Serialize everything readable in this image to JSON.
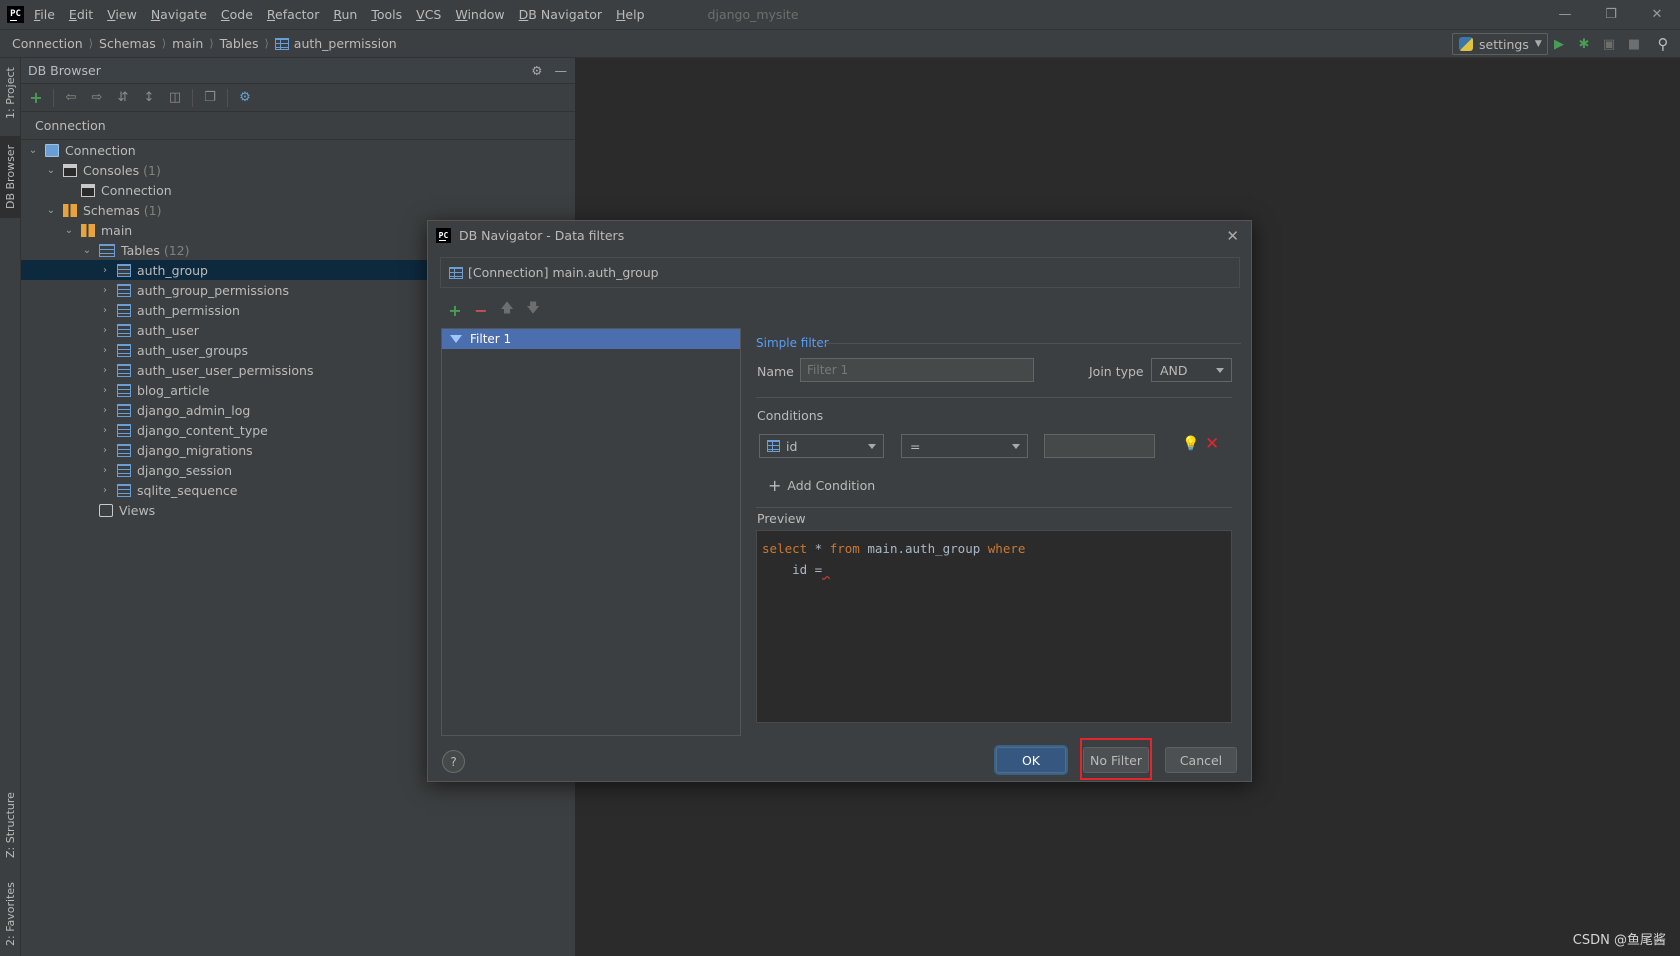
{
  "menubar": {
    "items": [
      "File",
      "Edit",
      "View",
      "Navigate",
      "Code",
      "Refactor",
      "Run",
      "Tools",
      "VCS",
      "Window",
      "DB Navigator",
      "Help"
    ],
    "project": "django_mysite"
  },
  "breadcrumb": [
    "Connection",
    "Schemas",
    "main",
    "Tables",
    "auth_permission"
  ],
  "run_config": "settings",
  "stripe": {
    "project": "1: Project",
    "db_browser": "DB Browser",
    "structure": "Z: Structure",
    "favorites": "2: Favorites"
  },
  "panel": {
    "title": "DB Browser",
    "column_header": "Connection"
  },
  "tree": {
    "connection": "Connection",
    "consoles": "Consoles",
    "consoles_count": "(1)",
    "console_conn": "Connection",
    "schemas": "Schemas",
    "schemas_count": "(1)",
    "main": "main",
    "tables": "Tables",
    "tables_count": "(12)",
    "table_items": [
      "auth_group",
      "auth_group_permissions",
      "auth_permission",
      "auth_user",
      "auth_user_groups",
      "auth_user_user_permissions",
      "blog_article",
      "django_admin_log",
      "django_content_type",
      "django_migrations",
      "django_session",
      "sqlite_sequence"
    ],
    "views": "Views"
  },
  "dialog": {
    "title": "DB Navigator - Data filters",
    "header": "[Connection] main.auth_group",
    "filter_item": "Filter 1",
    "simple_filter": "Simple filter",
    "name_label": "Name",
    "name_placeholder": "Filter 1",
    "join_type_label": "Join type",
    "join_type_value": "AND",
    "conditions_label": "Conditions",
    "cond_column": "id",
    "cond_operator": "=",
    "add_condition": "Add Condition",
    "preview_label": "Preview",
    "preview_line1_kw1": "select",
    "preview_line1_mid": " * ",
    "preview_line1_kw2": "from",
    "preview_line1_tbl": " main.auth_group ",
    "preview_line1_kw3": "where",
    "preview_line2": "    id =",
    "ok": "OK",
    "no_filter": "No Filter",
    "cancel": "Cancel",
    "help": "?"
  },
  "watermark": "CSDN @鱼尾酱"
}
